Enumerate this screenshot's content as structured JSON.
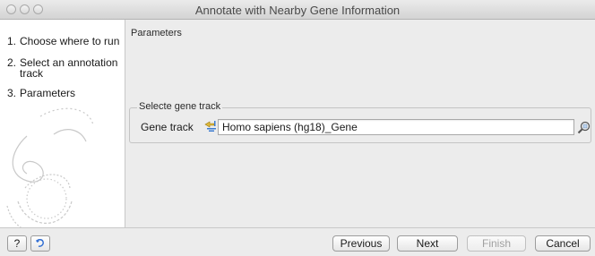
{
  "window": {
    "title": "Annotate with Nearby Gene Information"
  },
  "steps": [
    {
      "number": "1.",
      "label": "Choose where to run"
    },
    {
      "number": "2.",
      "label": "Select an annotation"
    },
    {
      "number": "",
      "label": "track"
    },
    {
      "number": "3.",
      "label": "Parameters"
    }
  ],
  "panel": {
    "section_title": "Parameters",
    "group_title": "Selecte gene track",
    "gene_track_label": "Gene track",
    "gene_track_value": "Homo sapiens (hg18)_Gene",
    "track_icon": "track-icon",
    "browse_icon": "browse-icon"
  },
  "footer": {
    "help_label": "?",
    "help_icon": "help-icon",
    "restore_icon": "restore-defaults-icon",
    "previous_label": "Previous",
    "next_label": "Next",
    "finish_label": "Finish",
    "cancel_label": "Cancel"
  }
}
